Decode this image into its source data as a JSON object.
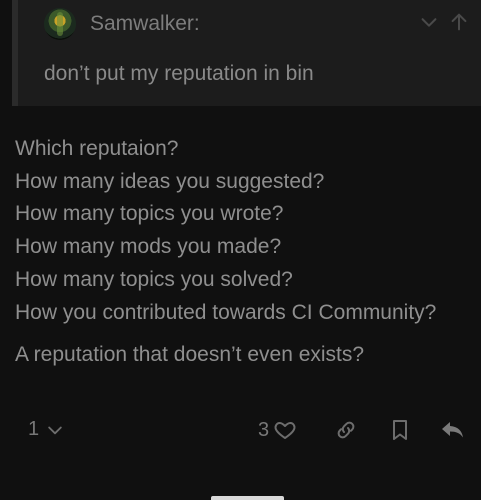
{
  "quote": {
    "username": "Samwalker:",
    "text": "don’t put my reputation in bin"
  },
  "post": {
    "lines": [
      "Which reputaion?",
      "How many ideas you suggested?",
      "How many topics you wrote?",
      "How many mods you made?",
      "How many topics you solved?",
      "How you contributed towards CI Community?"
    ],
    "closing": "A reputation that doesn’t even exists?"
  },
  "actions": {
    "replies_count": "1",
    "likes_count": "3"
  },
  "icons": {
    "expand": "chevron-down-icon",
    "jump": "arrow-up-icon",
    "like": "heart-icon",
    "link": "link-icon",
    "bookmark": "bookmark-icon",
    "reply": "reply-icon"
  }
}
